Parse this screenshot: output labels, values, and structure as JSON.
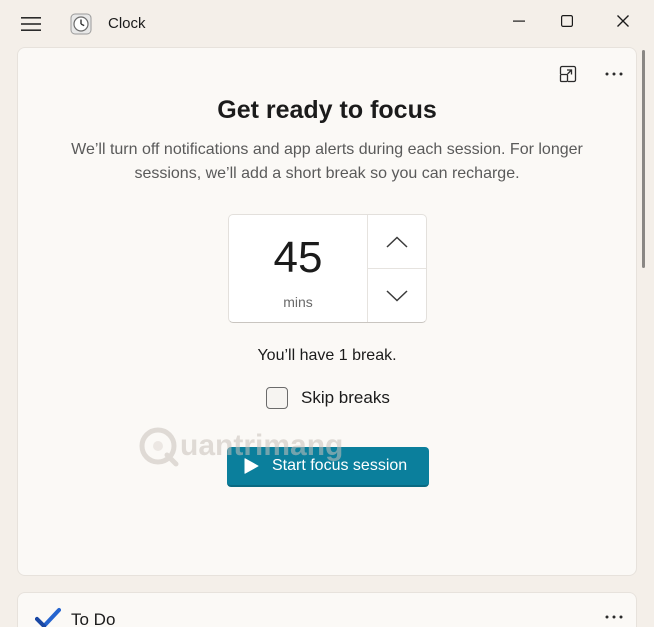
{
  "window": {
    "title": "Clock"
  },
  "focus": {
    "heading": "Get ready to focus",
    "description": "We’ll turn off notifications and app alerts during each session. For longer sessions, we’ll add a short break so you can recharge.",
    "timer_value": "45",
    "timer_unit": "mins",
    "break_info": "You’ll have 1 break.",
    "skip_breaks_label": "Skip breaks",
    "skip_breaks_checked": false,
    "start_label": "Start focus session"
  },
  "todo": {
    "title": "To Do"
  },
  "watermark": {
    "text": "uantrimang"
  },
  "icons": {
    "menu": "hamburger-icon",
    "app": "clock-app-icon",
    "minimize": "minimize-icon",
    "maximize": "maximize-icon",
    "close": "close-icon",
    "compact": "compact-overlay-icon",
    "more": "more-icon",
    "up": "chevron-up-icon",
    "down": "chevron-down-icon",
    "play": "play-icon",
    "todo": "todo-check-icon"
  },
  "colors": {
    "accent": "#0b7f9c",
    "window_bg": "#f4efe9",
    "card_bg": "#fbf9f6",
    "todo_check": "#2564cf"
  }
}
